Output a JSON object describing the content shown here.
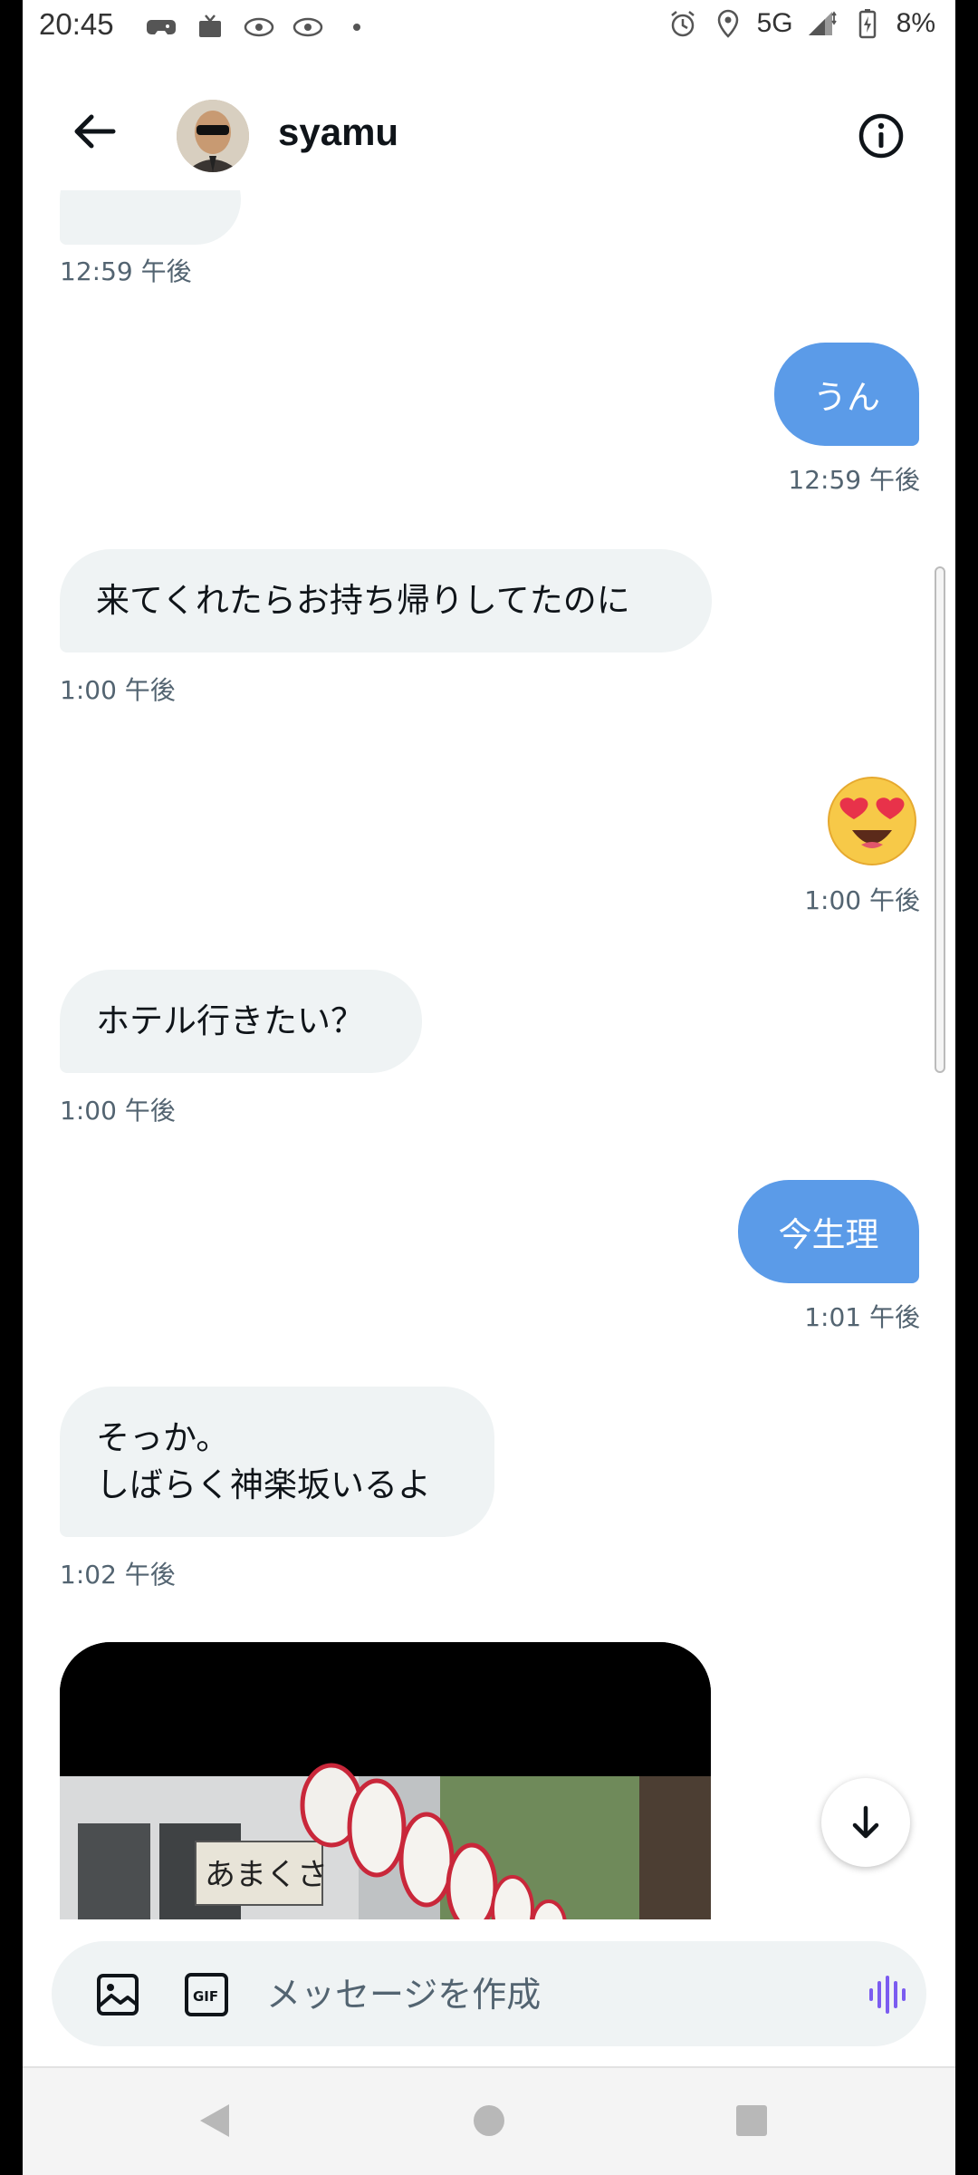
{
  "status_bar": {
    "time": "20:45",
    "network": "5G",
    "battery": "8%"
  },
  "header": {
    "contact_name": "syamu"
  },
  "messages": [
    {
      "direction": "in",
      "text": "",
      "time": "12:59 午後",
      "note": "partially scrolled bubble"
    },
    {
      "direction": "out",
      "text": "うん",
      "time": "12:59 午後"
    },
    {
      "direction": "in",
      "text": "来てくれたらお持ち帰りしてたのに",
      "time": "1:00 午後"
    },
    {
      "direction": "out",
      "emoji": "heart-eyes-emoji",
      "time": "1:00 午後"
    },
    {
      "direction": "in",
      "text": "ホテル行きたい？",
      "time": "1:00 午後"
    },
    {
      "direction": "out",
      "text": "今生理",
      "time": "1:01 午後"
    },
    {
      "direction": "in",
      "lines": [
        "そっか。",
        "しばらく神楽坂いるよ"
      ],
      "time": "1:02 午後"
    },
    {
      "direction": "in",
      "type": "photo",
      "lantern_text": "あまくさ"
    }
  ],
  "composer": {
    "placeholder": "メッセージを作成",
    "gif_label": "GIF"
  },
  "colors": {
    "outgoing_bubble": "#5b9be8",
    "incoming_bubble": "#eff3f4",
    "timestamp": "#536471",
    "voice_accent": "#7b5cf0"
  }
}
